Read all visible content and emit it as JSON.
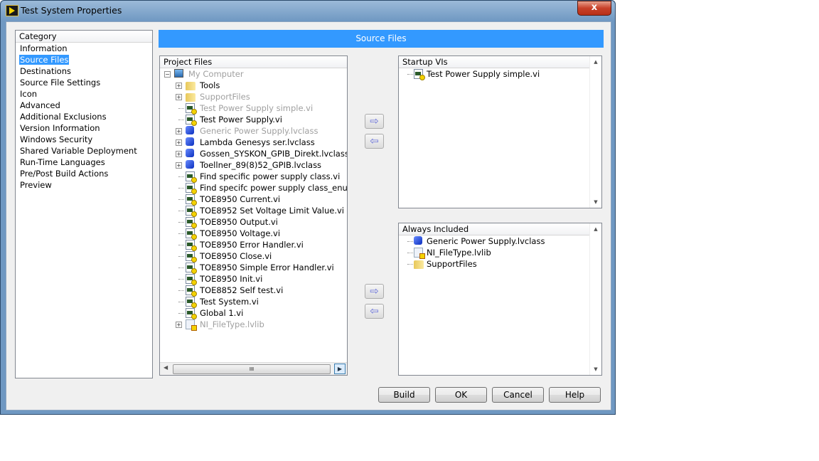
{
  "window": {
    "title": "Test System Properties",
    "close_label": "x"
  },
  "category": {
    "header": "Category",
    "selected": "Source Files",
    "items": [
      "Information",
      "Source Files",
      "Destinations",
      "Source File Settings",
      "Icon",
      "Advanced",
      "Additional Exclusions",
      "Version Information",
      "Windows Security",
      "Shared Variable Deployment",
      "Run-Time Languages",
      "Pre/Post Build Actions",
      "Preview"
    ]
  },
  "banner": "Source Files",
  "project_files": {
    "header": "Project Files",
    "items": [
      {
        "label": "My Computer",
        "icon": "computer-icon",
        "expander": "minus",
        "level": 0,
        "grey": true
      },
      {
        "label": "Tools",
        "icon": "folder-icon",
        "expander": "plus",
        "level": 1,
        "grey": false
      },
      {
        "label": "SupportFiles",
        "icon": "folder-icon",
        "expander": "plus",
        "level": 1,
        "grey": true
      },
      {
        "label": "Test Power Supply simple.vi",
        "icon": "vi-icon",
        "level": 1,
        "grey": true
      },
      {
        "label": "Test Power Supply.vi",
        "icon": "vi-icon",
        "level": 1,
        "grey": false
      },
      {
        "label": "Generic Power Supply.lvclass",
        "icon": "lvclass-icon",
        "expander": "plus",
        "level": 1,
        "grey": true
      },
      {
        "label": "Lambda Genesys ser.lvclass",
        "icon": "lvclass-icon",
        "expander": "plus",
        "level": 1,
        "grey": false
      },
      {
        "label": "Gossen_SYSKON_GPIB_Direkt.lvclass",
        "icon": "lvclass-icon",
        "expander": "plus",
        "level": 1,
        "grey": false
      },
      {
        "label": "Toellner_89(8)52_GPIB.lvclass",
        "icon": "lvclass-icon",
        "expander": "plus",
        "level": 1,
        "grey": false
      },
      {
        "label": "Find specific power supply class.vi",
        "icon": "vi-icon",
        "level": 1,
        "grey": false
      },
      {
        "label": "Find specifc power supply class_enum.vi",
        "icon": "vi-icon",
        "level": 1,
        "grey": false
      },
      {
        "label": "TOE8950 Current.vi",
        "icon": "vi-icon",
        "level": 1,
        "grey": false
      },
      {
        "label": "TOE8952 Set Voltage Limit Value.vi",
        "icon": "vi-icon",
        "level": 1,
        "grey": false
      },
      {
        "label": "TOE8950 Output.vi",
        "icon": "vi-icon",
        "level": 1,
        "grey": false
      },
      {
        "label": "TOE8950 Voltage.vi",
        "icon": "vi-icon",
        "level": 1,
        "grey": false
      },
      {
        "label": "TOE8950 Error Handler.vi",
        "icon": "vi-icon",
        "level": 1,
        "grey": false
      },
      {
        "label": "TOE8950 Close.vi",
        "icon": "vi-icon",
        "level": 1,
        "grey": false
      },
      {
        "label": "TOE8950 Simple Error Handler.vi",
        "icon": "vi-icon",
        "level": 1,
        "grey": false
      },
      {
        "label": "TOE8950 Init.vi",
        "icon": "vi-icon",
        "level": 1,
        "grey": false
      },
      {
        "label": "TOE8852 Self test.vi",
        "icon": "vi-icon",
        "level": 1,
        "grey": false
      },
      {
        "label": "Test System.vi",
        "icon": "vi-icon",
        "level": 1,
        "grey": false
      },
      {
        "label": "Global 1.vi",
        "icon": "vi-icon",
        "level": 1,
        "grey": false
      },
      {
        "label": "NI_FileType.lvlib",
        "icon": "lvlib-icon",
        "expander": "plus",
        "level": 1,
        "grey": true
      }
    ],
    "scroll_thumb": "III"
  },
  "startup_vis": {
    "header": "Startup VIs",
    "items": [
      {
        "label": "Test Power Supply simple.vi",
        "icon": "vi-icon"
      }
    ]
  },
  "always_included": {
    "header": "Always Included",
    "items": [
      {
        "label": "Generic Power Supply.lvclass",
        "icon": "lvclass-icon"
      },
      {
        "label": "NI_FileType.lvlib",
        "icon": "lvlib-icon"
      },
      {
        "label": "SupportFiles",
        "icon": "folder-icon"
      }
    ]
  },
  "arrows": {
    "add": "⇨",
    "remove": "⇦"
  },
  "buttons": {
    "build": "Build",
    "ok": "OK",
    "cancel": "Cancel",
    "help": "Help"
  },
  "scroll": {
    "up": "▲",
    "down": "▼",
    "left": "◀",
    "right": "▶"
  }
}
